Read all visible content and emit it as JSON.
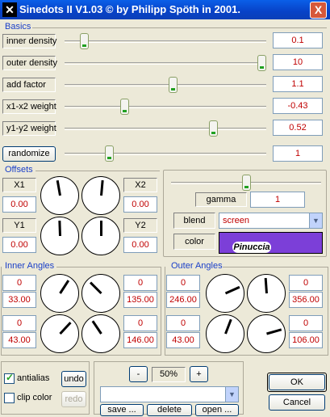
{
  "window": {
    "title": "Sinedots II V1.03 © by Philipp Spöth in 2001.",
    "icon": "app-x-icon",
    "close_glyph": "X"
  },
  "basics": {
    "label": "Basics",
    "params": [
      {
        "label": "inner density",
        "value": "0.1",
        "slider": 0.08
      },
      {
        "label": "outer density",
        "value": "10",
        "slider": 1.0
      },
      {
        "label": "add factor",
        "value": "1.1",
        "slider": 0.54
      },
      {
        "label": "x1-x2 weight",
        "value": "-0.43",
        "slider": 0.29
      },
      {
        "label": "y1-y2 weight",
        "value": "0.52",
        "slider": 0.75
      }
    ],
    "randomize_label": "randomize",
    "randomize_value": "1",
    "randomize_slider": 0.21
  },
  "offsets": {
    "label": "Offsets",
    "x1_label": "X1",
    "x1_value": "0.00",
    "x2_label": "X2",
    "x2_value": "0.00",
    "y1_label": "Y1",
    "y1_value": "0.00",
    "y2_label": "Y2",
    "y2_value": "0.00",
    "dial_angles_deg": [
      -10,
      5,
      -2,
      0
    ]
  },
  "color_panel": {
    "gamma_label": "gamma",
    "gamma_value": "1",
    "gamma_slider": 0.5,
    "blend_label": "blend",
    "blend_value": "screen",
    "color_label": "color",
    "color_hex": "#7c3fd8",
    "swatch_text": "Pinuccia"
  },
  "inner_angles": {
    "label": "Inner Angles",
    "rows": [
      {
        "left_top": "0",
        "left_bottom": "33.00",
        "right_top": "0",
        "right_bottom": "135.00"
      },
      {
        "left_top": "0",
        "left_bottom": "43.00",
        "right_top": "0",
        "right_bottom": "146.00"
      }
    ],
    "dial_angles_deg": [
      33,
      -45,
      43,
      -34
    ]
  },
  "outer_angles": {
    "label": "Outer Angles",
    "rows": [
      {
        "left_top": "0",
        "left_bottom": "246.00",
        "right_top": "0",
        "right_bottom": "356.00"
      },
      {
        "left_top": "0",
        "left_bottom": "43.00",
        "right_top": "0",
        "right_bottom": "106.00"
      }
    ],
    "dial_angles_deg": [
      66,
      -4,
      21,
      74
    ]
  },
  "footer": {
    "antialias_label": "antialias",
    "antialias_checked": true,
    "clipcolor_label": "clip color",
    "clipcolor_checked": false,
    "undo_label": "undo",
    "redo_label": "redo",
    "zoom_minus": "-",
    "zoom_value": "50%",
    "zoom_plus": "+",
    "save_label": "save ...",
    "delete_label": "delete",
    "open_label": "open ...",
    "ok_label": "OK",
    "cancel_label": "Cancel"
  }
}
